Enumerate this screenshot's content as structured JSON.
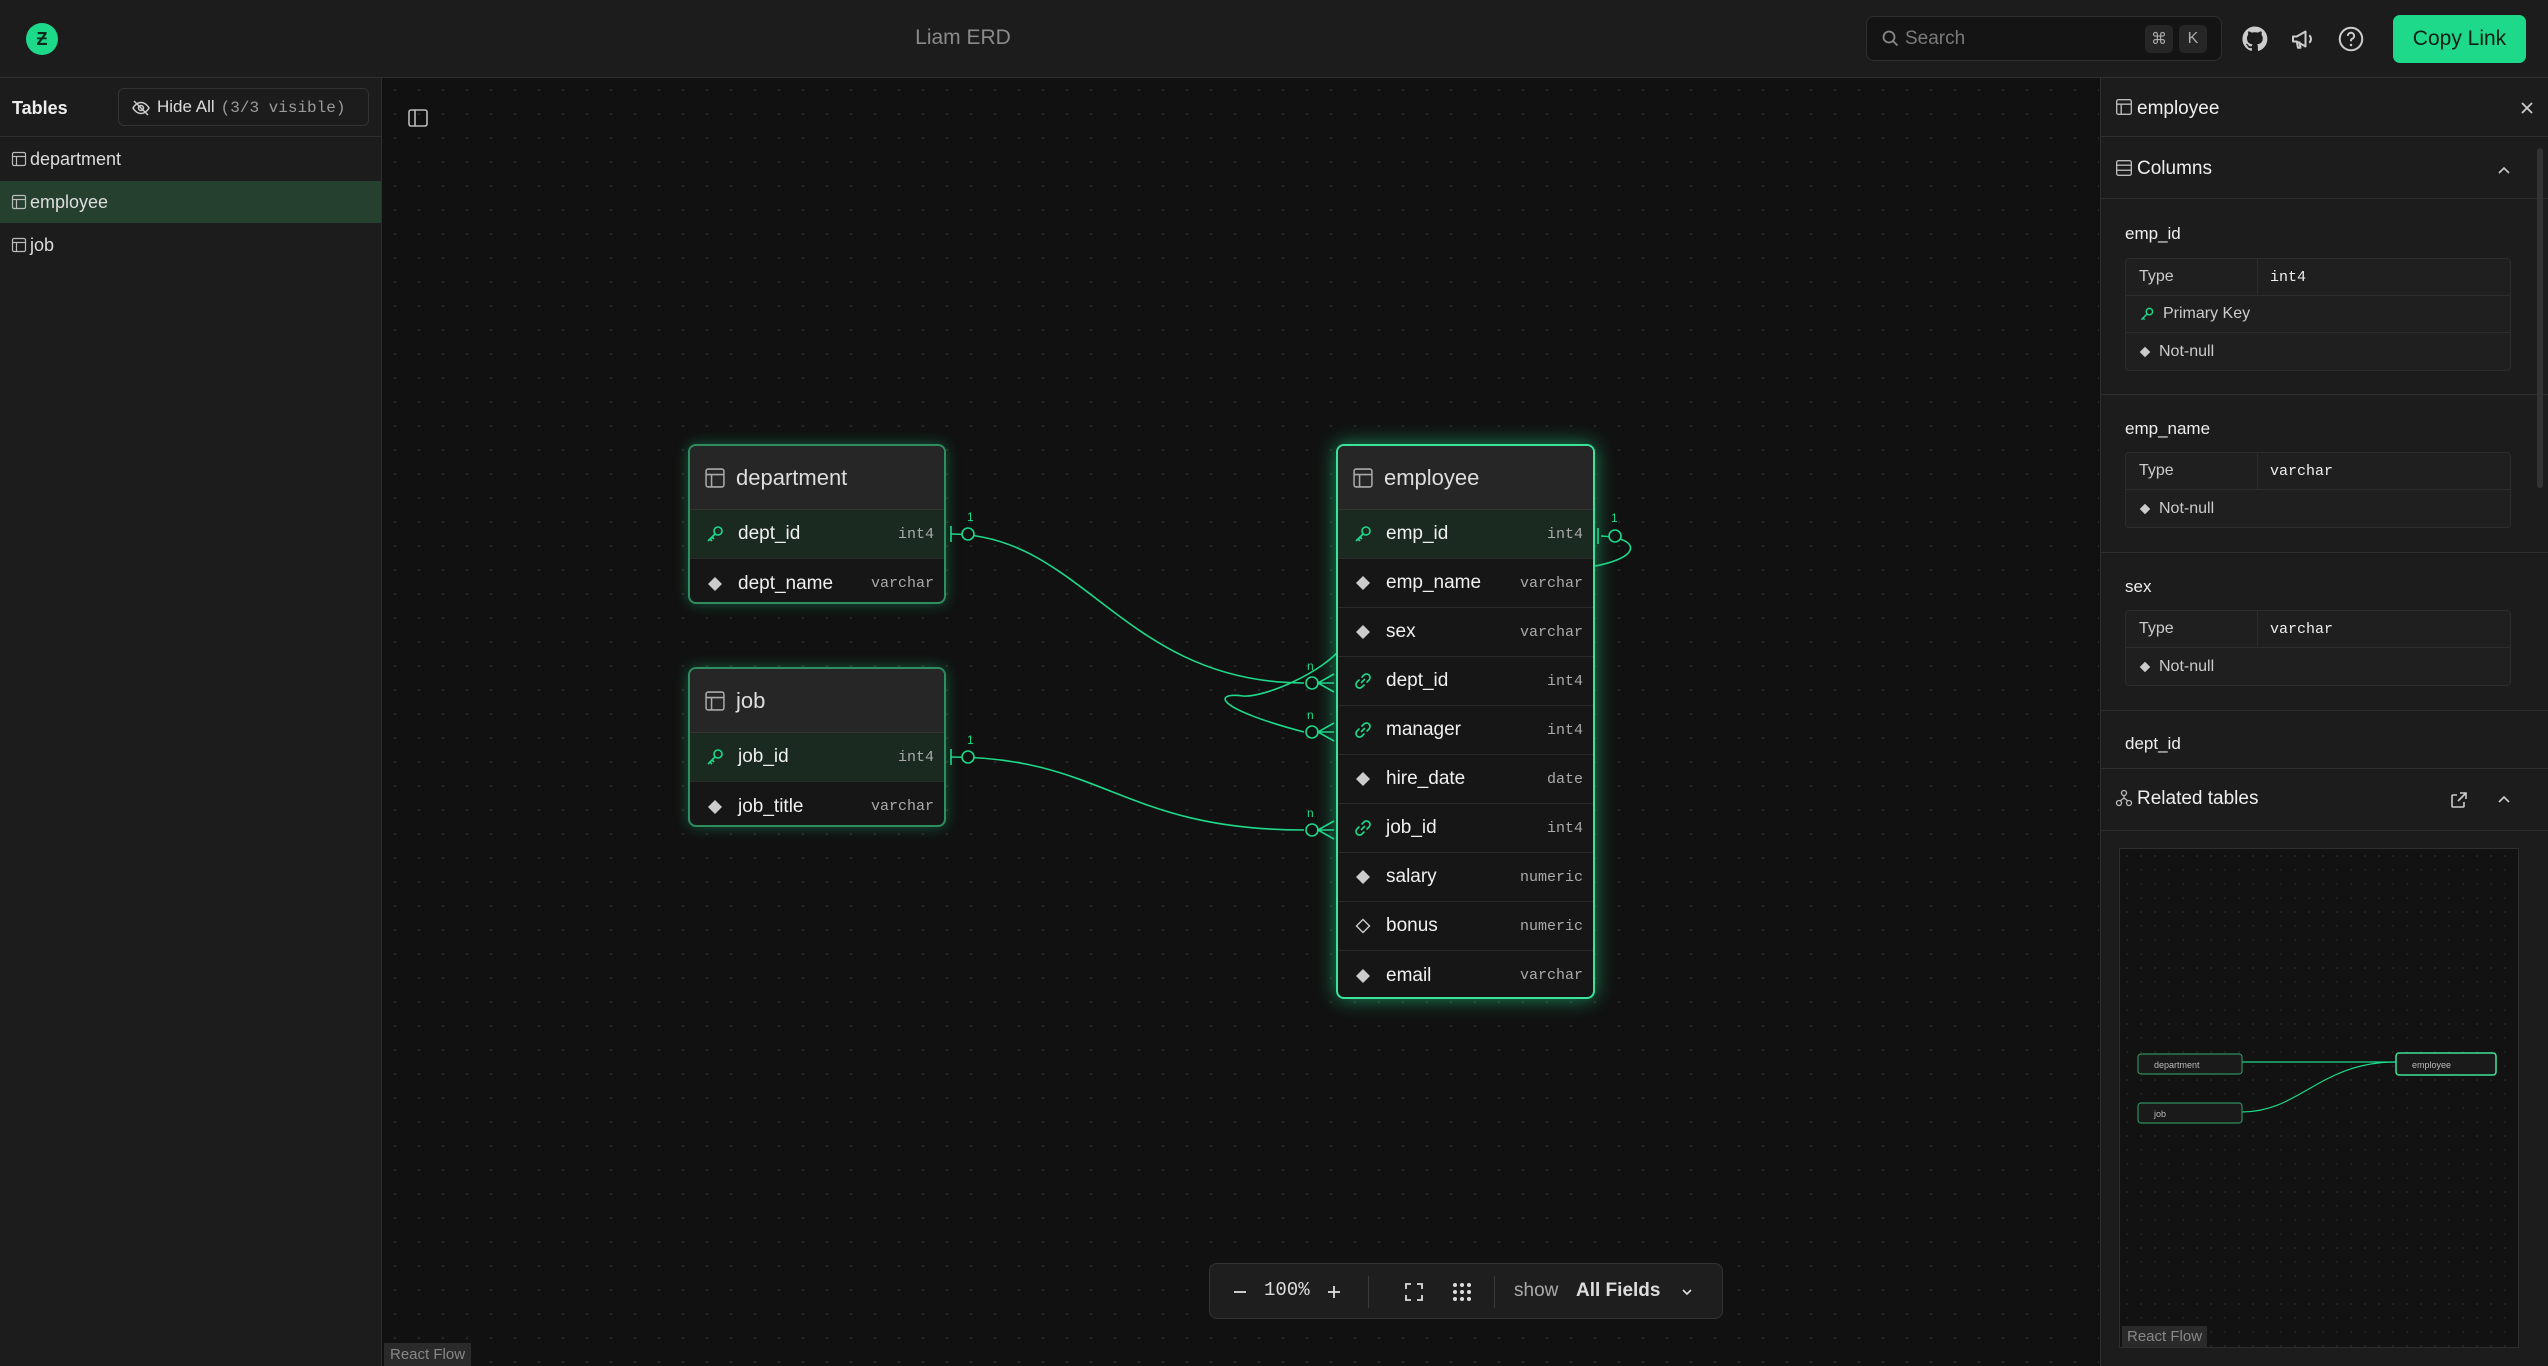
{
  "header": {
    "logo_letter": "Ƶ",
    "app_title": "Liam ERD",
    "search": {
      "placeholder": "Search",
      "kbd_cmd": "⌘",
      "kbd_key": "K"
    },
    "copy_link_label": "Copy Link",
    "icons": [
      "github-icon",
      "megaphone-icon",
      "help-icon"
    ]
  },
  "sidebar": {
    "title": "Tables",
    "hide_all_label": "Hide All",
    "visible_count": "(3/3 visible)",
    "items": [
      {
        "label": "department",
        "active": false
      },
      {
        "label": "employee",
        "active": true
      },
      {
        "label": "job",
        "active": false
      }
    ]
  },
  "canvas": {
    "attribution": "React Flow",
    "tables": {
      "department": {
        "name": "department",
        "columns": [
          {
            "name": "dept_id",
            "type": "int4",
            "kind": "pk"
          },
          {
            "name": "dept_name",
            "type": "varchar",
            "kind": "notnull"
          }
        ]
      },
      "job": {
        "name": "job",
        "columns": [
          {
            "name": "job_id",
            "type": "int4",
            "kind": "pk"
          },
          {
            "name": "job_title",
            "type": "varchar",
            "kind": "notnull"
          }
        ]
      },
      "employee": {
        "name": "employee",
        "columns": [
          {
            "name": "emp_id",
            "type": "int4",
            "kind": "pk"
          },
          {
            "name": "emp_name",
            "type": "varchar",
            "kind": "notnull"
          },
          {
            "name": "sex",
            "type": "varchar",
            "kind": "notnull"
          },
          {
            "name": "dept_id",
            "type": "int4",
            "kind": "fk"
          },
          {
            "name": "manager",
            "type": "int4",
            "kind": "fk"
          },
          {
            "name": "hire_date",
            "type": "date",
            "kind": "notnull"
          },
          {
            "name": "job_id",
            "type": "int4",
            "kind": "fk"
          },
          {
            "name": "salary",
            "type": "numeric",
            "kind": "notnull"
          },
          {
            "name": "bonus",
            "type": "numeric",
            "kind": "nullable"
          },
          {
            "name": "email",
            "type": "varchar",
            "kind": "notnull"
          }
        ]
      }
    },
    "cardinality": {
      "one": "1",
      "many": "n"
    }
  },
  "toolbar": {
    "zoom": "100%",
    "show_label": "show",
    "show_value": "All Fields"
  },
  "panel": {
    "title": "employee",
    "columns_title": "Columns",
    "type_label": "Type",
    "pk_label": "Primary Key",
    "notnull_label": "Not-null",
    "columns": [
      {
        "name": "emp_id",
        "type": "int4"
      },
      {
        "name": "emp_name",
        "type": "varchar"
      },
      {
        "name": "sex",
        "type": "varchar"
      },
      {
        "name": "dept_id"
      }
    ],
    "related_title": "Related tables",
    "minimap": {
      "department": "department",
      "job": "job",
      "employee": "employee",
      "attribution": "React Flow"
    }
  },
  "colors": {
    "accent": "#1ed98a",
    "border": "#2e8e5f",
    "bg": "#111111"
  }
}
